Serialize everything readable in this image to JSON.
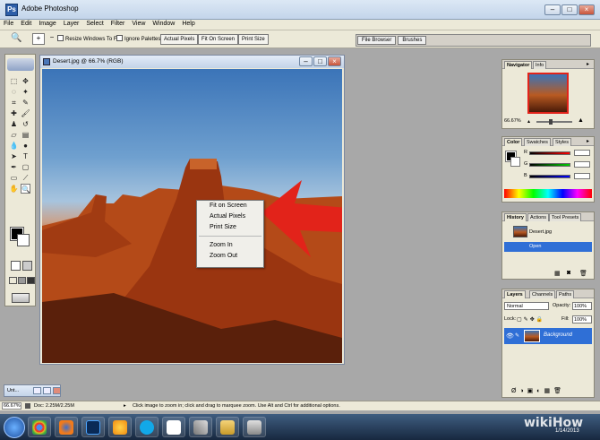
{
  "app": {
    "title": "Adobe Photoshop"
  },
  "menu": [
    "File",
    "Edit",
    "Image",
    "Layer",
    "Select",
    "Filter",
    "View",
    "Window",
    "Help"
  ],
  "options": {
    "resize_windows": "Resize Windows To Fit",
    "ignore_palettes": "Ignore Palettes",
    "actual_pixels": "Actual Pixels",
    "fit_on_screen": "Fit On Screen",
    "print_size": "Print Size",
    "tabs": [
      "File Browser",
      "Brushes"
    ]
  },
  "document": {
    "title": "Desert.jpg @ 66.7% (RGB)"
  },
  "context_menu": [
    "Fit on Screen",
    "Actual Pixels",
    "Print Size",
    "Zoom In",
    "Zoom Out"
  ],
  "navigator": {
    "tabs": [
      "Navigator",
      "Info"
    ],
    "zoom": "66.67%"
  },
  "color": {
    "tabs": [
      "Color",
      "Swatches",
      "Styles"
    ],
    "channels": [
      "R",
      "G",
      "B"
    ],
    "accent_red": "#e2231a"
  },
  "history": {
    "tabs": [
      "History",
      "Actions",
      "Tool Presets"
    ],
    "snapshot": "Desert.jpg",
    "step": "Open"
  },
  "layers": {
    "tabs": [
      "Layers",
      "Channels",
      "Paths"
    ],
    "blend": "Normal",
    "opacity_label": "Opacity:",
    "opacity": "100%",
    "lock_label": "Lock:",
    "fill_label": "Fill:",
    "fill": "100%",
    "layer_name": "Background"
  },
  "minimized_doc": "Unt...",
  "status": {
    "zoom": "66.67%",
    "doc": "Doc: 2.25M/2.25M",
    "hint": "Click image to zoom in; click and drag to marquee zoom. Use Alt and Ctrl for additional options."
  },
  "taskbar": {
    "date": "1/14/2013"
  },
  "watermark": "wikiHow"
}
